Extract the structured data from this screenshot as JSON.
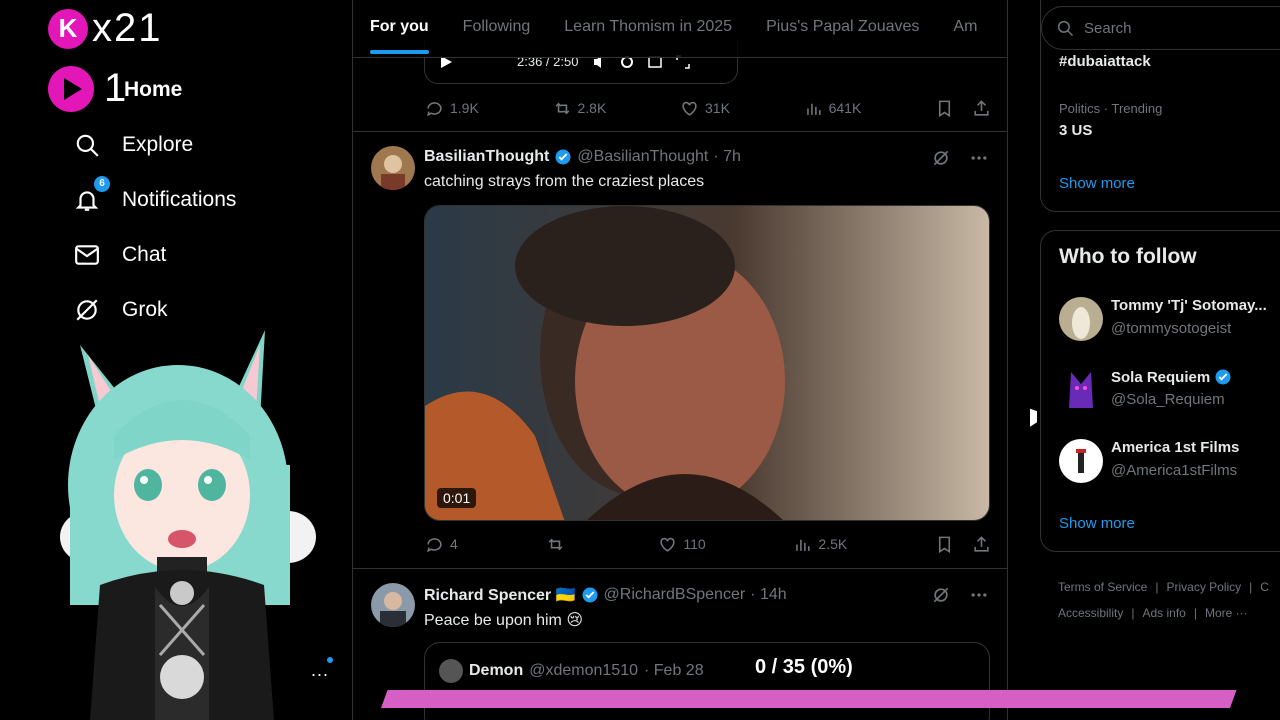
{
  "brand": {
    "logo_letter": "K",
    "logo_text": "x21",
    "home_digit": "1"
  },
  "sidebar": {
    "items": [
      {
        "label": "Home",
        "icon": "home-icon"
      },
      {
        "label": "Explore",
        "icon": "search-icon"
      },
      {
        "label": "Notifications",
        "icon": "bell-icon",
        "badge": "6"
      },
      {
        "label": "Chat",
        "icon": "mail-icon"
      },
      {
        "label": "Grok",
        "icon": "grok-icon"
      }
    ],
    "more": "..."
  },
  "tabs": [
    "For you",
    "Following",
    "Learn Thomism in 2025",
    "Pius's Papal Zouaves",
    "Am"
  ],
  "player": {
    "time": "2:36 / 2:50"
  },
  "tweets": [
    {
      "stats": {
        "replies": "1.9K",
        "reposts": "2.8K",
        "likes": "31K",
        "views": "641K"
      }
    },
    {
      "name": "BasilianThought",
      "handle": "@BasilianThought",
      "time": "· 7h",
      "text": "catching strays from the craziest places",
      "video_timer": "0:01",
      "stats": {
        "replies": "4",
        "reposts": "",
        "likes": "110",
        "views": "2.5K"
      }
    },
    {
      "name": "Richard Spencer 🇺🇦",
      "handle": "@RichardBSpencer",
      "time": "· 14h",
      "text": "Peace be upon him 😢",
      "quote": {
        "name": "Demon",
        "handle": "@xdemon1510",
        "time": "· Feb 28"
      }
    }
  ],
  "progress": {
    "text": "0 / 35 (0%)",
    "fraction": 0
  },
  "search": {
    "placeholder": "Search"
  },
  "trends": [
    {
      "title": "#dubaiattack"
    },
    {
      "meta": "Politics · Trending",
      "title": "3 US"
    }
  ],
  "trends_show_more": "Show more",
  "who_to_follow": {
    "title": "Who to follow",
    "users": [
      {
        "name": "Tommy 'Tj' Sotomay...",
        "handle": "@tommysotogeist",
        "verified": false
      },
      {
        "name": "Sola Requiem",
        "handle": "@Sola_Requiem",
        "verified": true
      },
      {
        "name": "America 1st Films",
        "handle": "@America1stFilms",
        "verified": false
      }
    ],
    "show_more": "Show more"
  },
  "footer": {
    "links": [
      "Terms of Service",
      "Privacy Policy",
      "C",
      "Accessibility",
      "Ads info",
      "More ···"
    ]
  },
  "colors": {
    "accent": "#1d9bf0",
    "brand_pink": "#e316b8",
    "progress": "#d65fc5"
  }
}
